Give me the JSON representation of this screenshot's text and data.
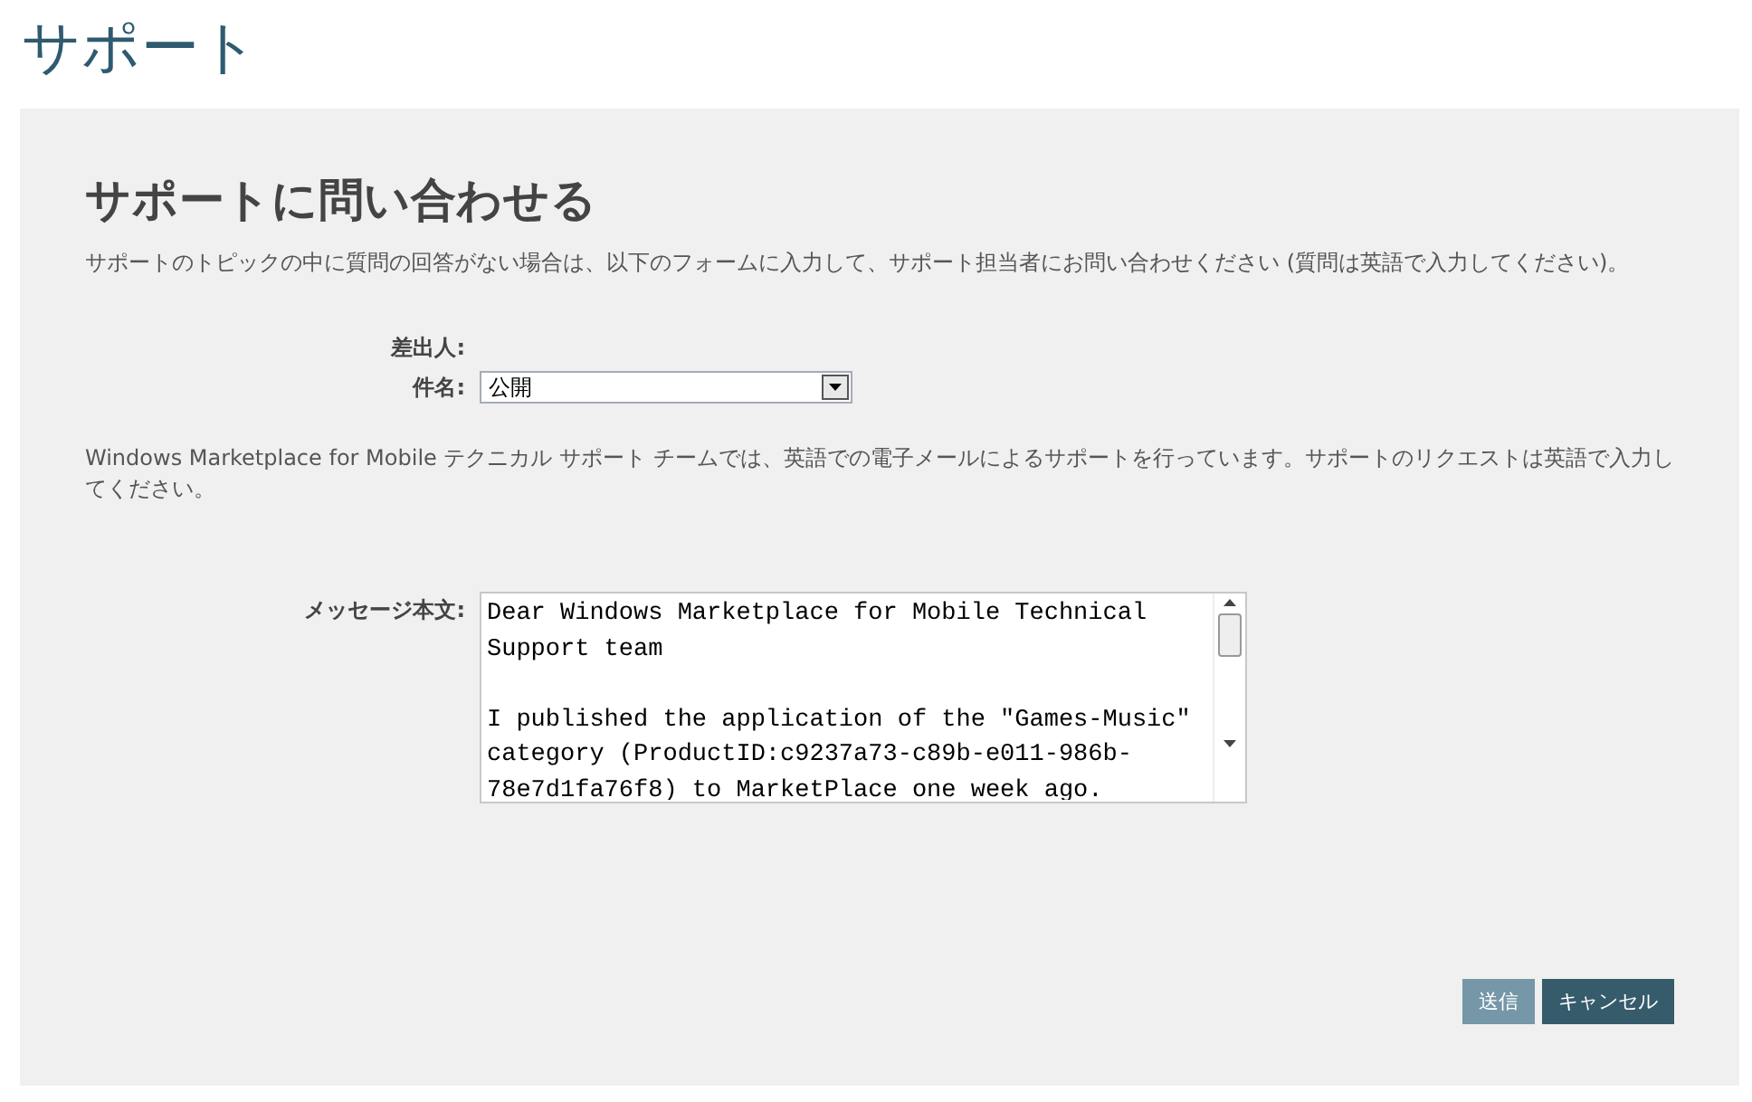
{
  "page_title": "サポート",
  "form": {
    "heading": "サポートに問い合わせる",
    "intro": "サポートのトピックの中に質問の回答がない場合は、以下のフォームに入力して、サポート担当者にお問い合わせください (質問は英語で入力してください)。",
    "sender_label": "差出人:",
    "subject_label": "件名:",
    "subject_value": "公開",
    "notice": "Windows Marketplace for Mobile テクニカル サポート チームでは、英語での電子メールによるサポートを行っています。サポートのリクエストは英語で入力してください。",
    "message_label": "メッセージ本文:",
    "message_paragraphs": [
      "Dear Windows Marketplace for Mobile Technical Support team",
      "I published the application of the \"Games-Music\" category (ProductID:c9237a73-c89b-e011-986b-78e7d1fa76f8) to MarketPlace one week ago."
    ],
    "buttons": [
      {
        "label": "送信",
        "kind": "primary"
      },
      {
        "label": "キャンセル",
        "kind": "secondary"
      }
    ]
  }
}
